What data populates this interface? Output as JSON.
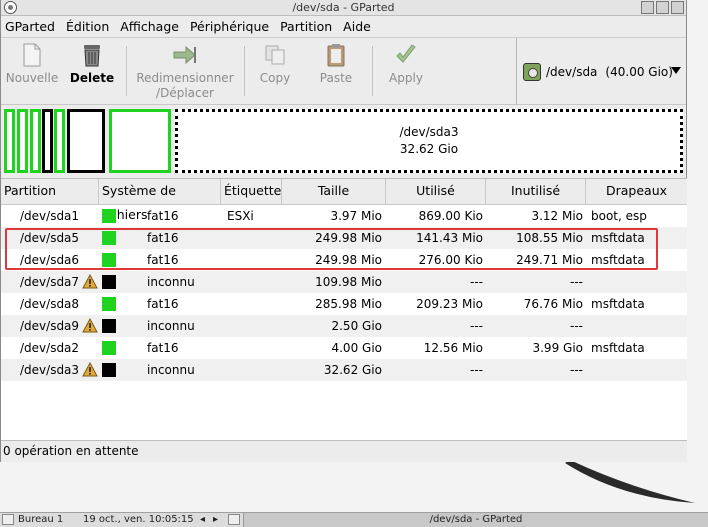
{
  "window": {
    "title": "/dev/sda - GParted"
  },
  "menu": [
    "GParted",
    "Édition",
    "Affichage",
    "Périphérique",
    "Partition",
    "Aide"
  ],
  "toolbar": {
    "new": "Nouvelle",
    "delete": "Delete",
    "resize_line1": "Redimensionner",
    "resize_line2": "/Déplacer",
    "copy": "Copy",
    "paste": "Paste",
    "apply": "Apply"
  },
  "device": {
    "name": "/dev/sda",
    "size": "(40.00 Gio)"
  },
  "diskmap": {
    "selected_name": "/dev/sda3",
    "selected_size": "32.62 Gio"
  },
  "columns": [
    "Partition",
    "Système de fichiers",
    "Étiquette",
    "Taille",
    "Utilisé",
    "Inutilisé",
    "Drapeaux"
  ],
  "partitions": [
    {
      "name": "/dev/sda1",
      "warn": false,
      "color": "#21d321",
      "fs": "fat16",
      "label": "ESXi",
      "size": "3.97 Mio",
      "used": "869.00 Kio",
      "unused": "3.12 Mio",
      "flags": "boot, esp"
    },
    {
      "name": "/dev/sda5",
      "warn": false,
      "color": "#21d321",
      "fs": "fat16",
      "label": "",
      "size": "249.98 Mio",
      "used": "141.43 Mio",
      "unused": "108.55 Mio",
      "flags": "msftdata"
    },
    {
      "name": "/dev/sda6",
      "warn": false,
      "color": "#21d321",
      "fs": "fat16",
      "label": "",
      "size": "249.98 Mio",
      "used": "276.00 Kio",
      "unused": "249.71 Mio",
      "flags": "msftdata"
    },
    {
      "name": "/dev/sda7",
      "warn": true,
      "color": "#000000",
      "fs": "inconnu",
      "label": "",
      "size": "109.98 Mio",
      "used": "---",
      "unused": "---",
      "flags": ""
    },
    {
      "name": "/dev/sda8",
      "warn": false,
      "color": "#21d321",
      "fs": "fat16",
      "label": "",
      "size": "285.98 Mio",
      "used": "209.23 Mio",
      "unused": "76.76 Mio",
      "flags": "msftdata"
    },
    {
      "name": "/dev/sda9",
      "warn": true,
      "color": "#000000",
      "fs": "inconnu",
      "label": "",
      "size": "2.50 Gio",
      "used": "---",
      "unused": "---",
      "flags": ""
    },
    {
      "name": "/dev/sda2",
      "warn": false,
      "color": "#21d321",
      "fs": "fat16",
      "label": "",
      "size": "4.00 Gio",
      "used": "12.56 Mio",
      "unused": "3.99 Gio",
      "flags": "msftdata"
    },
    {
      "name": "/dev/sda3",
      "warn": true,
      "color": "#000000",
      "fs": "inconnu",
      "label": "",
      "size": "32.62 Gio",
      "used": "---",
      "unused": "---",
      "flags": ""
    }
  ],
  "status": "0 opération en attente",
  "taskbar": {
    "workspace": "Bureau 1",
    "datetime": "19 oct., ven. 10:05:15",
    "active_window": "/dev/sda - GParted"
  },
  "colors": {
    "fat16": "#21d321",
    "unknown": "#000000",
    "highlight": "#e0383a"
  }
}
